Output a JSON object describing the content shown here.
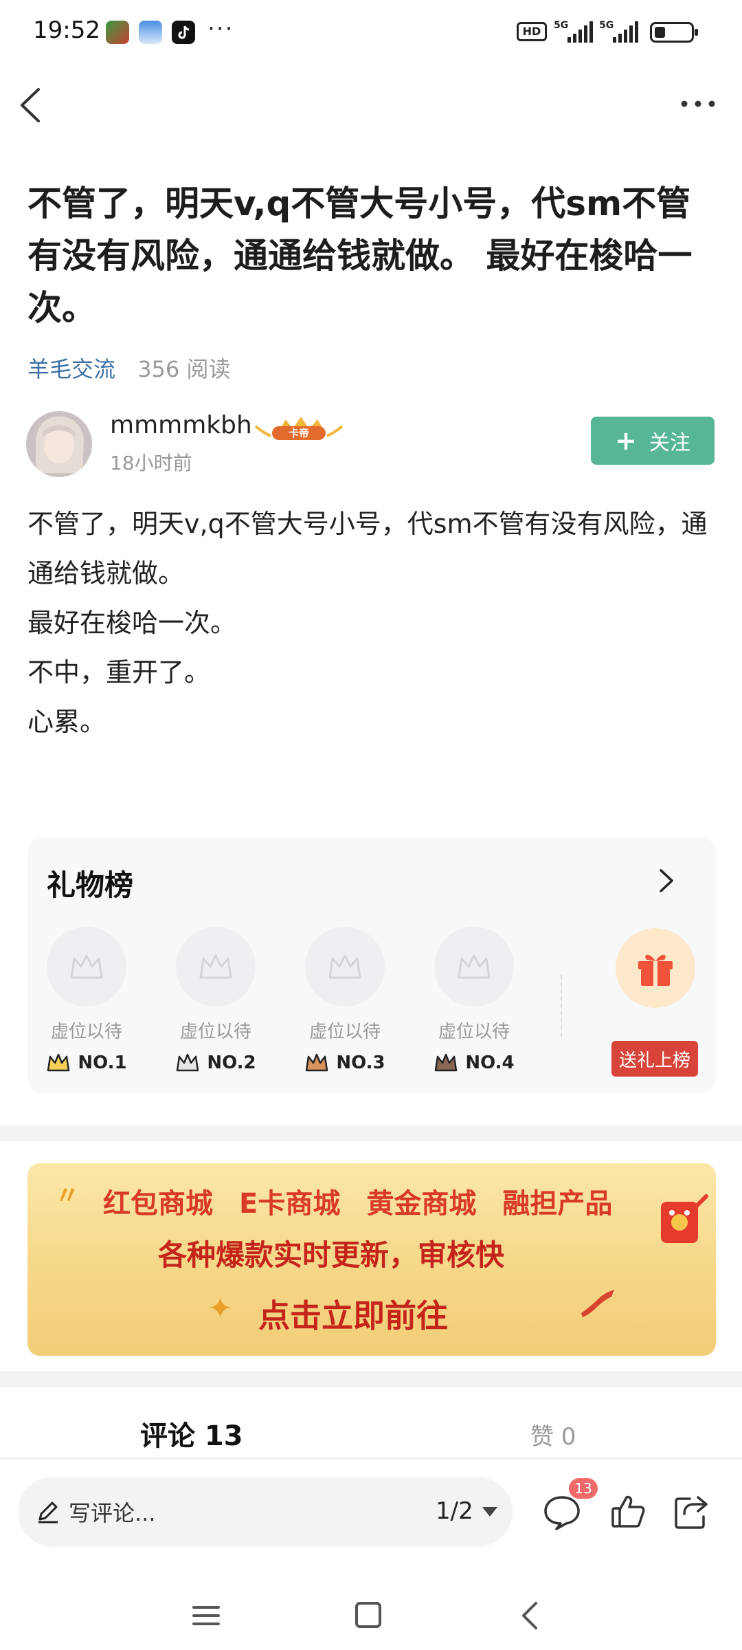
{
  "status_bar": {
    "time": "19:52",
    "network": "HD",
    "signal_1": "5G",
    "signal_2": "5G",
    "battery_level": 0.3
  },
  "post": {
    "title": "不管了，明天v,q不管大号小号，代sm不管有没有风险，通通给钱就做。 最好在梭哈一次。",
    "category": "羊毛交流",
    "reads": "356 阅读",
    "author": "mmmmkbh",
    "author_badge": "卡帝",
    "time_ago": "18小时前",
    "follow_label": "关注",
    "body_lines": [
      "不管了，明天v,q不管大号小号，代sm不管有没有风险，通通给钱就做。",
      "最好在梭哈一次。",
      "不中，重开了。",
      "心累。"
    ]
  },
  "gift_board": {
    "title": "礼物榜",
    "slots": [
      {
        "label": "虚位以待",
        "rank": "NO.1",
        "crown_color": "#e7b63a"
      },
      {
        "label": "虚位以待",
        "rank": "NO.2",
        "crown_color": "#9aa0a8"
      },
      {
        "label": "虚位以待",
        "rank": "NO.3",
        "crown_color": "#c77c44"
      },
      {
        "label": "虚位以待",
        "rank": "NO.4",
        "crown_color": "#7a5a4a"
      }
    ],
    "send_label": "送礼上榜"
  },
  "banner": {
    "items": [
      "红包商城",
      "E卡商城",
      "黄金商城",
      "融担产品"
    ],
    "subtitle": "各种爆款实时更新，审核快",
    "cta": "点击立即前往"
  },
  "tabs": {
    "comments": "评论 13",
    "likes": "赞 0"
  },
  "bottom_bar": {
    "placeholder": "写评论...",
    "page": "1/2",
    "comment_count": "13"
  },
  "colors": {
    "accent_green": "#56b697",
    "link_blue": "#3a6ea5",
    "gift_red": "#d9443a",
    "badge_red": "#f06a6a"
  }
}
